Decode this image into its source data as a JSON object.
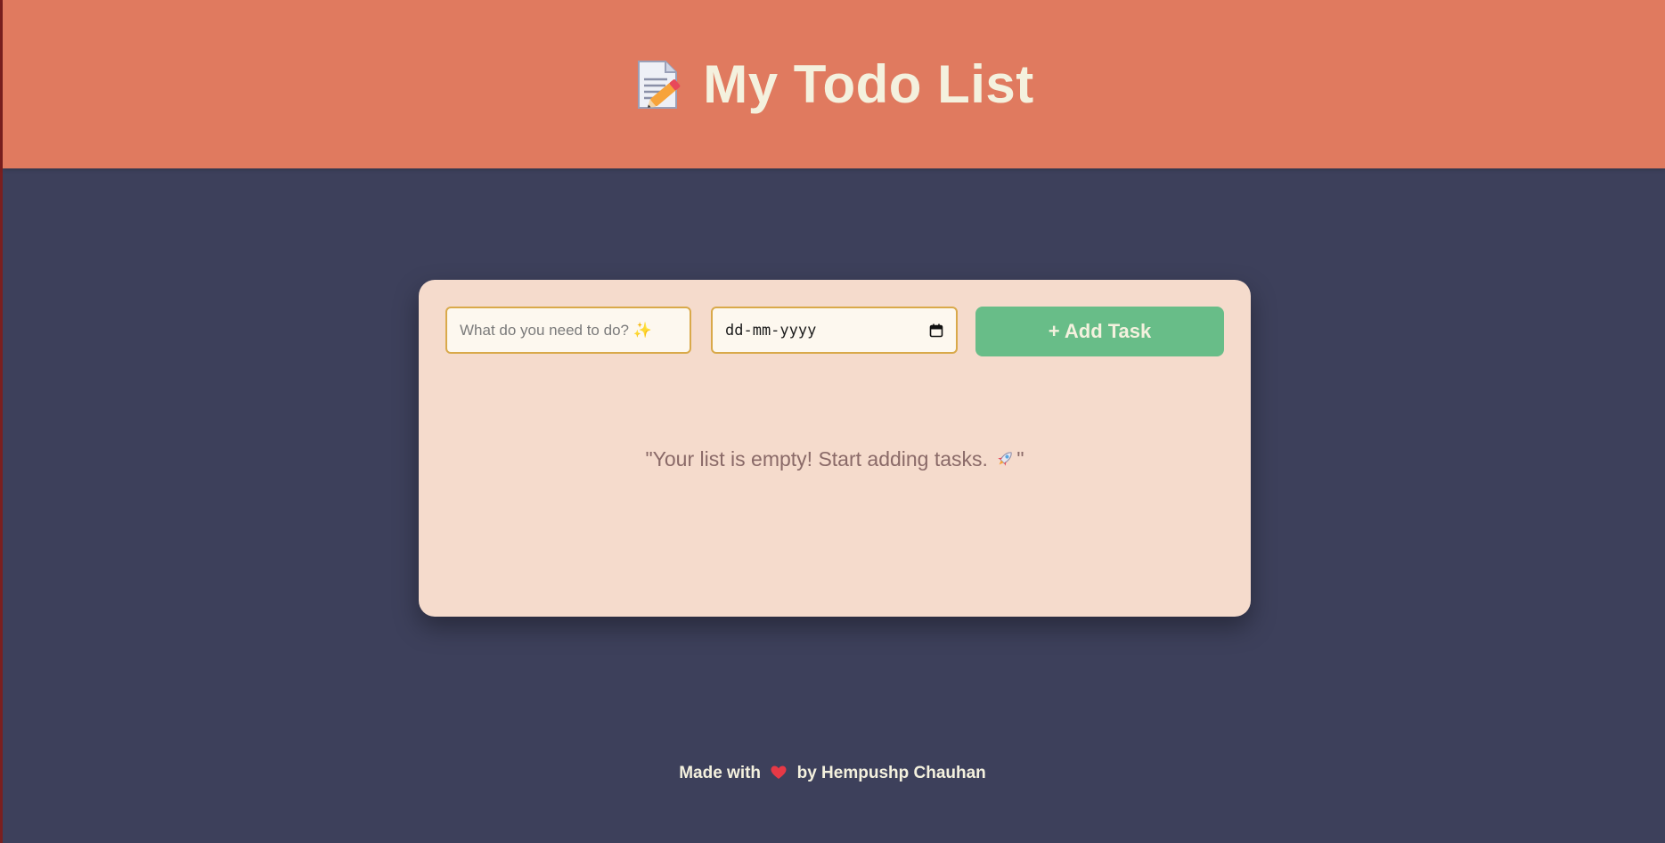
{
  "header": {
    "title": "My Todo List",
    "icon": "memo-pencil-icon",
    "background": "#e07a5f"
  },
  "form": {
    "task_placeholder": "What do you need to do? ✨",
    "date_placeholder": "dd-mm-yyyy",
    "add_button_label": "+ Add Task"
  },
  "list": {
    "empty_message_start": "\"Your list is empty! Start adding tasks.",
    "empty_message_end": "\""
  },
  "footer": {
    "prefix": "Made with",
    "suffix": "by Hempushp Chauhan"
  },
  "colors": {
    "page_background": "#3d405b",
    "card_background": "#f5dbcc",
    "button_green": "#68bd88",
    "input_border": "#d9a94a",
    "text_light": "#f4f1de"
  }
}
